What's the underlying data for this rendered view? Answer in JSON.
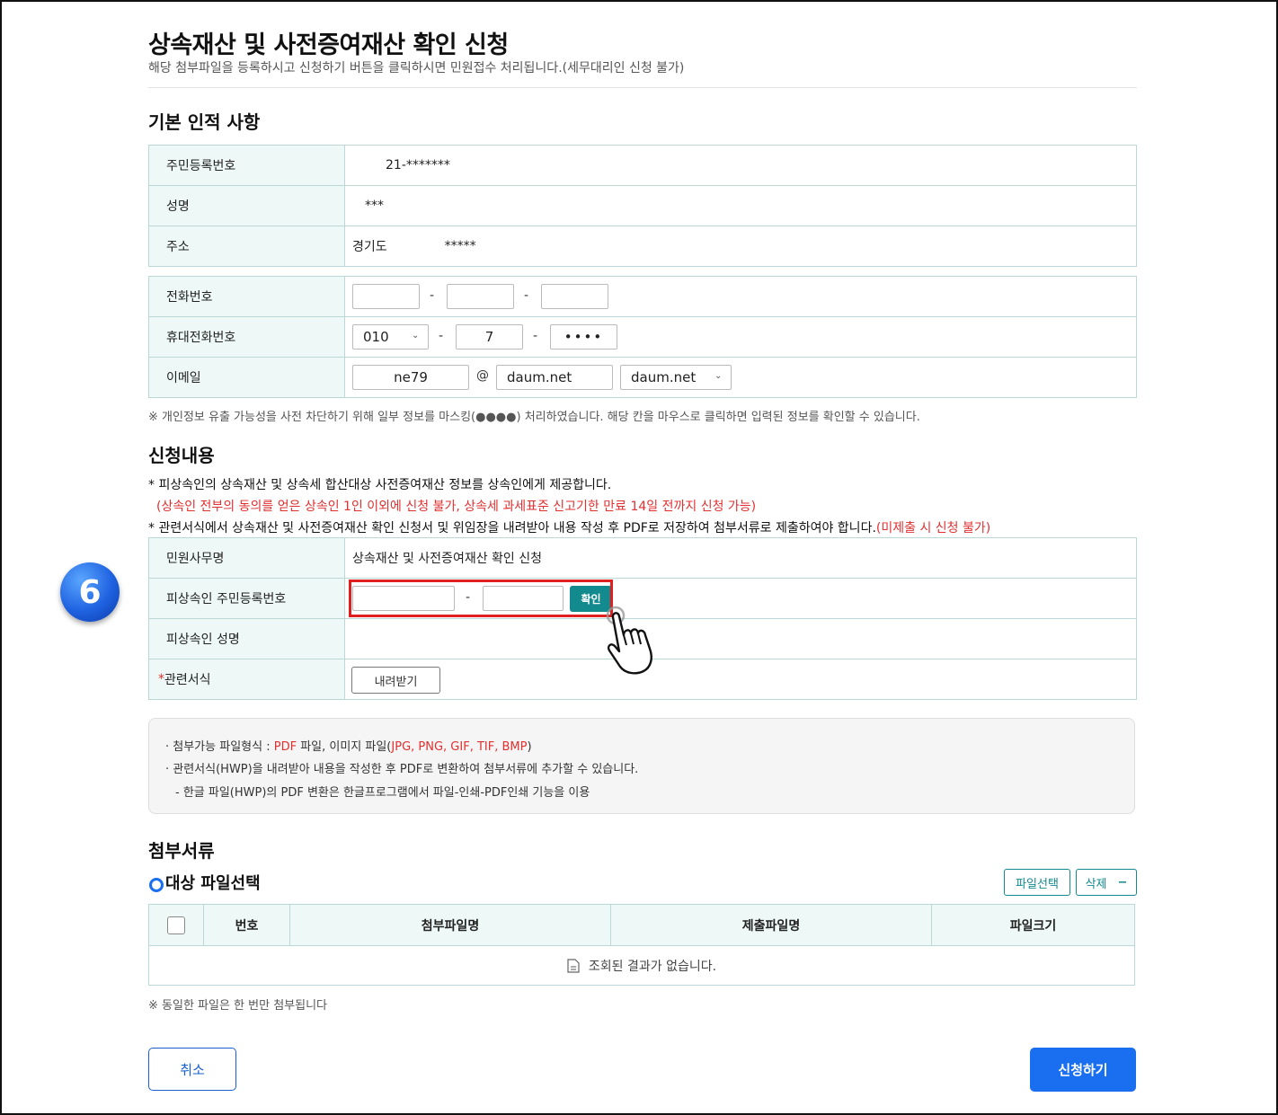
{
  "page": {
    "title": "상속재산 및 사전증여재산 확인 신청",
    "subtitle": "해당 첨부파일을 등록하시고 신청하기 버튼을 클릭하시면 민원접수 처리됩니다.(세무대리인 신청 불가)"
  },
  "basic": {
    "heading": "기본 인적 사항",
    "rrn_label": "주민등록번호",
    "rrn_value": "21-*******",
    "name_label": "성명",
    "name_value": "***",
    "addr_label": "주소",
    "addr_value1": "경기도",
    "addr_value2": "*****"
  },
  "contact": {
    "phone_label": "전화번호",
    "mobile_label": "휴대전화번호",
    "mobile_prefix": "010",
    "mobile_mid": "7",
    "mobile_last": "••••",
    "email_label": "이메일",
    "email_id": "ne79",
    "email_at": "@",
    "email_domain": "daum.net",
    "email_domain_select": "daum.net",
    "dash": "-",
    "notice": "※ 개인정보 유출 가능성을 사전 차단하기 위해 일부 정보를 마스킹(●●●●) 처리하였습니다. 해당 칸을 마우스로 클릭하면 입력된 정보를 확인할 수 있습니다."
  },
  "application": {
    "heading": "신청내용",
    "bullet1": "* 피상속인의 상속재산 및 상속세 합산대상 사전증여재산 정보를 상속인에게 제공합니다.",
    "bullet1_red": "(상속인 전부의 동의를 얻은 상속인 1인 이외에 신청 불가, 상속세 과세표준 신고기한 만료 14일 전까지 신청 가능)",
    "bullet2": "* 관련서식에서 상속재산 및 사전증여재산 확인 신청서 및 위임장을 내려받아 내용 작성 후 PDF로 저장하여 첨부서류로 제출하여야 합니다.",
    "bullet2_red": "(미제출 시 신청 불가)",
    "service_label": "민원사무명",
    "service_value": "상속재산 및 사전증여재산 확인 신청",
    "deceased_rrn_label": "피상속인 주민등록번호",
    "confirm_button": "확인",
    "deceased_name_label": "피상속인 성명",
    "form_required": "*",
    "form_label": "관련서식",
    "download_button": "내려받기"
  },
  "info": {
    "line1_a": "· 첨부가능 파일형식 : ",
    "line1_b": "PDF",
    "line1_c": " 파일, 이미지 파일(",
    "line1_d": "JPG, PNG, GIF, TIF, BMP",
    "line1_e": ")",
    "line2": "· 관련서식(HWP)을 내려받아 내용을 작성한 후 PDF로 변환하여 첨부서류에 추가할 수 있습니다.",
    "line3": "- 한글 파일(HWP)의 PDF 변환은 한글프로그램에서 파일-인쇄-PDF인쇄 기능을 이용"
  },
  "attachments": {
    "heading": "첨부서류",
    "subheading": "대상 파일선택",
    "select_button": "파일선택",
    "delete_button": "삭제",
    "delete_symbol": "−",
    "columns": [
      "번호",
      "첨부파일명",
      "제출파일명",
      "파일크기"
    ],
    "empty_text": "조회된 결과가 없습니다.",
    "note": "※ 동일한 파일은 한 번만 첨부됩니다"
  },
  "footer": {
    "cancel_button": "취소",
    "submit_button": "신청하기"
  },
  "overlay": {
    "step_number": "6"
  }
}
